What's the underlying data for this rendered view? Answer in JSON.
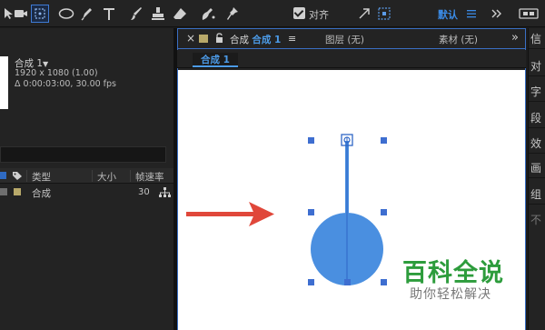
{
  "toolbar": {
    "tools": [
      {
        "icon": "pointer-icon"
      },
      {
        "icon": "hand-icon"
      },
      {
        "icon": "zoom-icon"
      },
      {
        "icon": "rotate-icon"
      },
      {
        "icon": "camera-icon"
      },
      {
        "icon": "pan-behind-icon"
      },
      {
        "icon": "ellipse-icon"
      },
      {
        "icon": "pen-icon"
      },
      {
        "icon": "text-icon"
      },
      {
        "icon": "brush-icon"
      },
      {
        "icon": "clone-stamp-icon"
      },
      {
        "icon": "eraser-icon"
      },
      {
        "icon": "roto-brush-icon"
      },
      {
        "icon": "puppet-pin-icon"
      }
    ],
    "align_label": "对齐",
    "workspace_label": "默认"
  },
  "project": {
    "comp_name": "合成 1",
    "resolution": "1920 x 1080 (1.00)",
    "duration": "Δ 0:00:03:00, 30.00 fps",
    "columns": {
      "type": "类型",
      "size": "大小",
      "fps": "帧速率"
    },
    "items": [
      {
        "name": "合成",
        "fps": "30",
        "label_color": "#b8a96a"
      }
    ]
  },
  "comp_panel": {
    "tab_close": "×",
    "tab_prefix": "合成",
    "tab_name": "合成 1",
    "tab_menu": "≡",
    "layer_tab": "图层 (无)",
    "footage_tab": "素材 (无)",
    "overflow": "»",
    "sub_tab": "合成 1"
  },
  "right_rail": {
    "items": [
      "信",
      "对",
      "字",
      "段",
      "效",
      "画",
      "组",
      "不"
    ]
  },
  "watermark": {
    "title": "百科全说",
    "subtitle": "助你轻松解决"
  },
  "colors": {
    "accent": "#3b8be6",
    "shape_fill": "#4a8fe0",
    "arrow": "#e0473a",
    "watermark_green": "#2d9c3c"
  }
}
